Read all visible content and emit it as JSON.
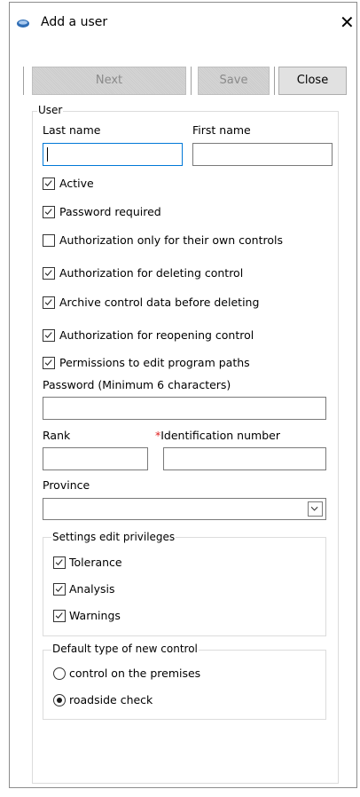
{
  "window": {
    "title": "Add a user",
    "close_glyph": "✕"
  },
  "toolbar": {
    "next_label": "Next",
    "save_label": "Save",
    "close_label": "Close"
  },
  "user_group": {
    "legend": "User"
  },
  "fields": {
    "last_name": {
      "label": "Last name",
      "value": ""
    },
    "first_name": {
      "label": "First name",
      "value": ""
    },
    "password": {
      "label": "Password (Minimum 6 characters)",
      "value": ""
    },
    "rank": {
      "label": "Rank",
      "value": ""
    },
    "identification": {
      "label": "Identification number",
      "required_mark": "*",
      "value": ""
    },
    "province": {
      "label": "Province",
      "value": ""
    }
  },
  "checkboxes": [
    {
      "label": "Active",
      "checked": true
    },
    {
      "label": "Password required",
      "checked": true
    },
    {
      "label": "Authorization only for their own controls",
      "checked": false
    },
    {
      "label": "Authorization for deleting control",
      "checked": true
    },
    {
      "label": "Archive control data before deleting",
      "checked": true
    },
    {
      "label": "Authorization for reopening control",
      "checked": true
    },
    {
      "label": "Permissions to edit program paths",
      "checked": true
    }
  ],
  "settings_privileges": {
    "legend": "Settings edit privileges",
    "items": [
      {
        "label": "Tolerance",
        "checked": true
      },
      {
        "label": "Analysis",
        "checked": true
      },
      {
        "label": "Warnings",
        "checked": true
      }
    ]
  },
  "default_control_type": {
    "legend": "Default type of new control",
    "options": [
      {
        "label": "control on the premises",
        "selected": false
      },
      {
        "label": "roadside check",
        "selected": true
      }
    ]
  },
  "icons": {
    "app": "app-eye-icon",
    "close": "close-icon",
    "check": "check-mark-icon",
    "dropdown": "chevron-down-icon"
  }
}
